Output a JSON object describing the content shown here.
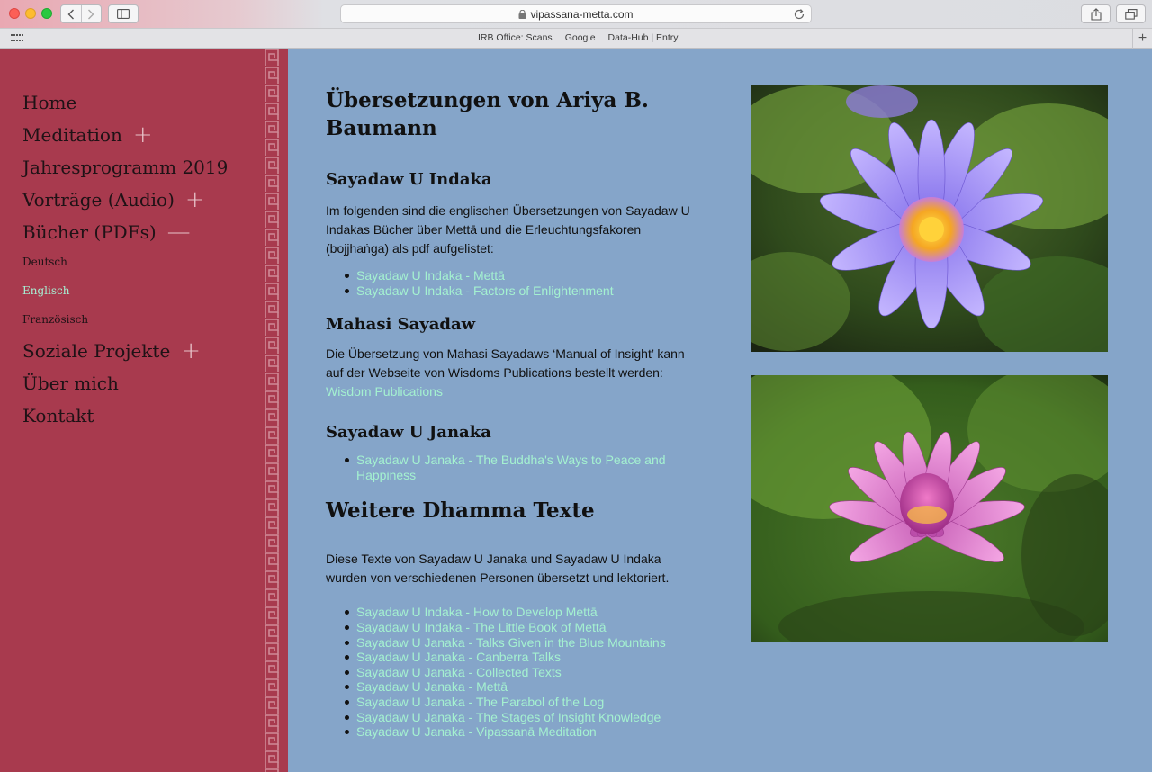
{
  "browser": {
    "url": "vipassana-metta.com",
    "bookmarks": [
      "IRB Office: Scans",
      "Google",
      "Data-Hub | Entry"
    ]
  },
  "sidebar": {
    "nav": [
      {
        "label": "Home",
        "toggle": ""
      },
      {
        "label": "Meditation",
        "toggle": "+"
      },
      {
        "label": "Jahresprogramm 2019",
        "toggle": ""
      },
      {
        "label": "Vorträge (Audio)",
        "toggle": "+"
      },
      {
        "label": "Bücher (PDFs)",
        "toggle": "—"
      }
    ],
    "subnav": [
      {
        "label": "Deutsch"
      },
      {
        "label": "Englisch"
      },
      {
        "label": "Französisch"
      }
    ],
    "nav2": [
      {
        "label": "Soziale Projekte",
        "toggle": "+"
      },
      {
        "label": "Über mich",
        "toggle": ""
      },
      {
        "label": "Kontakt",
        "toggle": ""
      }
    ]
  },
  "main": {
    "title": "Übersetzungen von Ariya B. Baumann",
    "indaka": {
      "heading": "Sayadaw U Indaka",
      "text": "Im folgenden sind die englischen Übersetzungen von Sayadaw U Indakas Bücher über Mettā und die Erleuchtungsfakoren (bojjhaṅga) als pdf aufgelistet:",
      "links": [
        "Sayadaw U Indaka - Mettā",
        "Sayadaw U Indaka - Factors of Enlightenment"
      ]
    },
    "mahasi": {
      "heading": "Mahasi Sayadaw",
      "text": "Die Übersetzung von Mahasi Sayadaws ‘Manual of Insight’ kann auf der Webseite von Wisdoms Publications bestellt werden:",
      "link": "Wisdom Publications"
    },
    "janaka": {
      "heading": "Sayadaw U Janaka",
      "links": [
        "Sayadaw U Janaka - The Buddha's Ways to Peace and Happiness"
      ]
    },
    "weitere": {
      "heading": "Weitere Dhamma Texte",
      "text": "Diese Texte von Sayadaw U Janaka und Sayadaw U Indaka wurden von verschiedenen Personen übersetzt und lektoriert.",
      "links": [
        "Sayadaw U Indaka - How to Develop Mettā",
        "Sayadaw U Indaka - The Little Book of Mettā",
        "Sayadaw U Janaka - Talks Given in the Blue Mountains",
        "Sayadaw U Janaka - Canberra Talks",
        "Sayadaw U Janaka - Collected Texts",
        "Sayadaw U Janaka - Mettā",
        "Sayadaw U Janaka - The Parabol of the Log",
        "Sayadaw U Janaka - The Stages of Insight Knowledge",
        "Sayadaw U Janaka - Vipassanā Meditation"
      ]
    }
  },
  "images": [
    {
      "name": "blue-water-lily-photo"
    },
    {
      "name": "pink-water-lily-photo"
    }
  ],
  "colors": {
    "sidebar": "#a83a4e",
    "content_bg": "#85a5c9",
    "link": "#a4f1d0"
  }
}
